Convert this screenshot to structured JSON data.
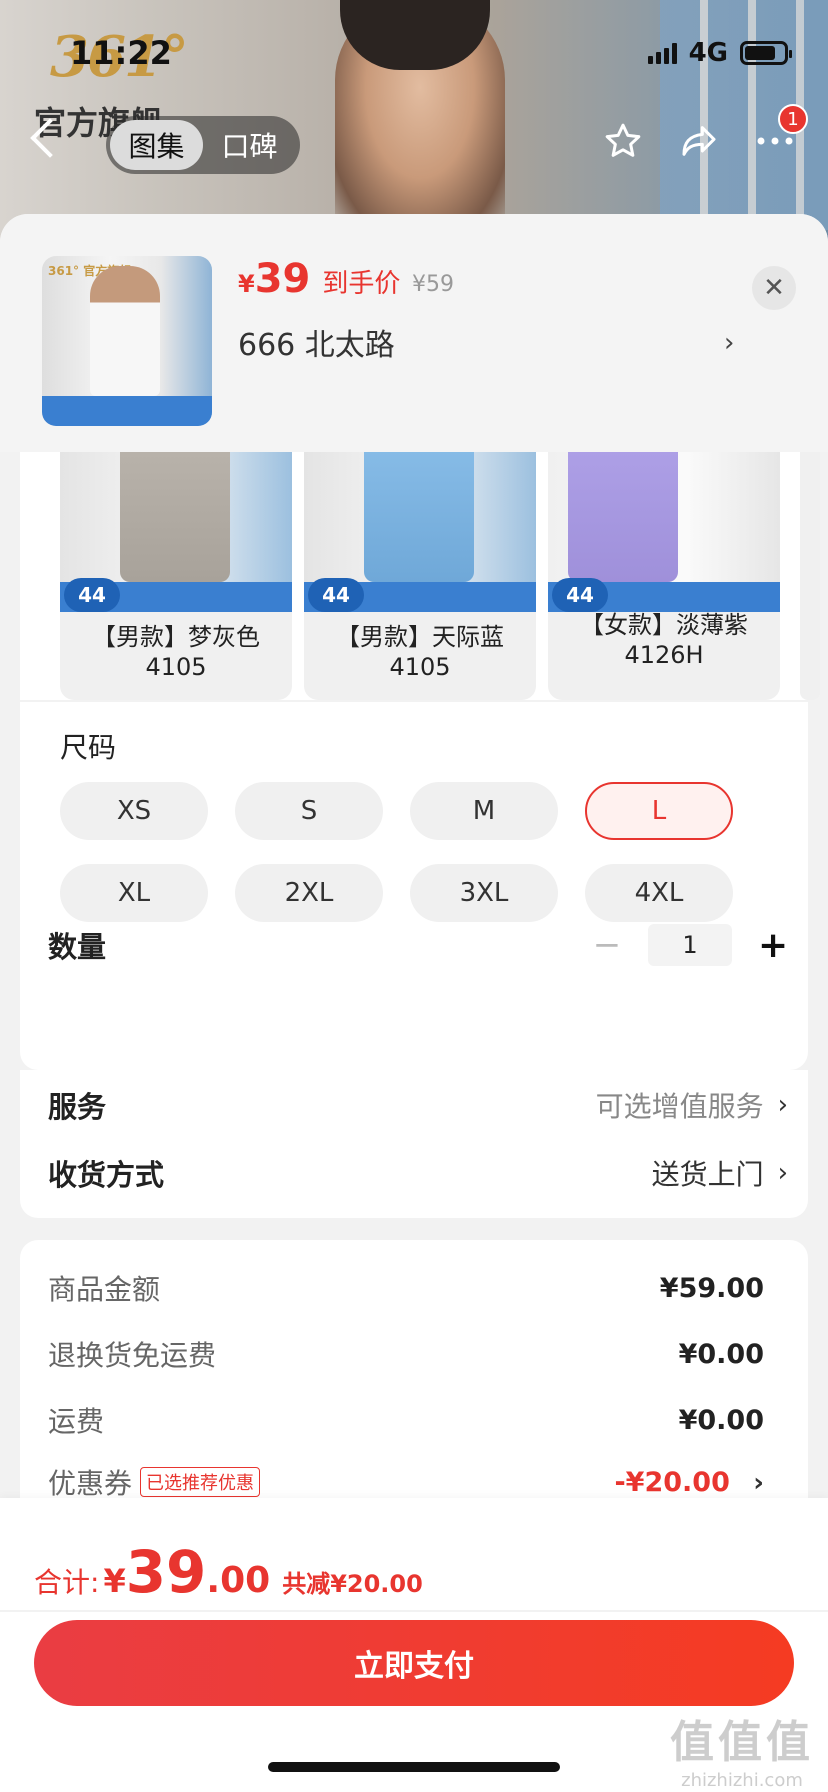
{
  "status_bar": {
    "time": "11:22",
    "network": "4G"
  },
  "hero": {
    "brand_logo": "361°",
    "brand_sub": "官方旗舰"
  },
  "nav": {
    "tabs": [
      {
        "label": "图集",
        "active": true
      },
      {
        "label": "口碑",
        "active": false
      }
    ],
    "badge_count": "1"
  },
  "product": {
    "currency": "¥",
    "price": "39",
    "price_tag": "到手价",
    "original_price": "¥59",
    "address": "666  北太路",
    "thumb_logo": "361° 官方旗舰"
  },
  "variants": [
    {
      "label": "【男款】梦灰色 4105",
      "badge": "44",
      "color": "#b8b2aa"
    },
    {
      "label": "【男款】天际蓝 4105",
      "badge": "44",
      "color": "#7fb4e0"
    },
    {
      "label": "【女款】淡薄紫 4126H",
      "badge": "44",
      "color": "#a99be2"
    }
  ],
  "size": {
    "title": "尺码",
    "options": [
      "XS",
      "S",
      "M",
      "L",
      "XL",
      "2XL",
      "3XL",
      "4XL"
    ],
    "selected": "L"
  },
  "quantity": {
    "label": "数量",
    "value": "1",
    "minus": "−",
    "plus": "+"
  },
  "service": {
    "label": "服务",
    "value": "可选增值服务"
  },
  "delivery": {
    "label": "收货方式",
    "value": "送货上门"
  },
  "price_detail": [
    {
      "label": "商品金额",
      "value": "¥59.00"
    },
    {
      "label": "退换货免运费",
      "value": "¥0.00"
    },
    {
      "label": "运费",
      "value": "¥0.00"
    },
    {
      "label": "优惠券",
      "tag": "已选推荐优惠",
      "value": "-¥20.00"
    }
  ],
  "total": {
    "label": "合计:",
    "currency": "¥",
    "integer": "39",
    "decimal": ".00",
    "savings": "共减¥20.00"
  },
  "pay_button": "立即支付",
  "watermark": {
    "big": "值值值",
    "small": "zhizhizhi.com"
  },
  "colors": {
    "accent": "#e8352f",
    "badge_blue": "#3a7fd0"
  }
}
